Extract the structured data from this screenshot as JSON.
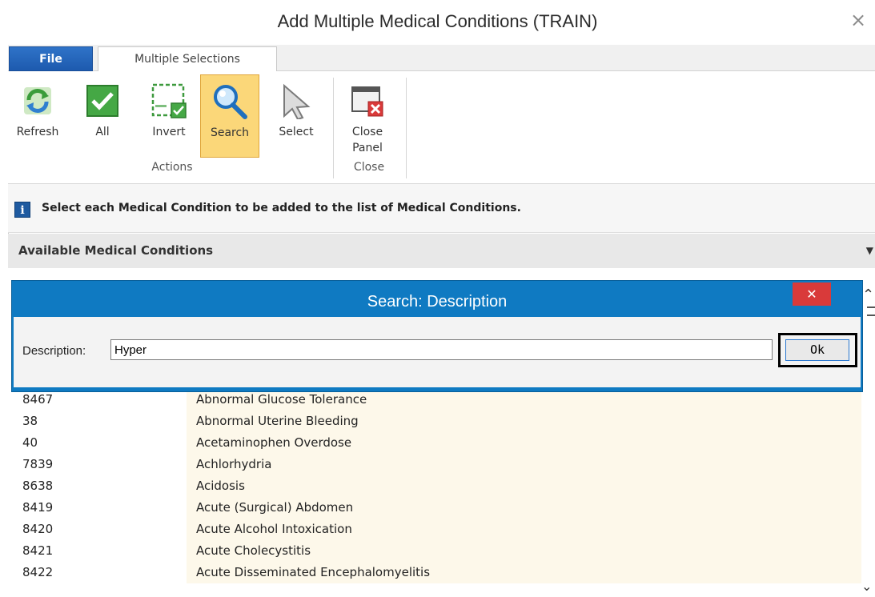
{
  "window": {
    "title": "Add Multiple Medical Conditions (TRAIN)",
    "close_glyph": "×"
  },
  "ribbon": {
    "tabs": [
      {
        "label": "File"
      },
      {
        "label": "Multiple Selections"
      }
    ],
    "buttons": [
      {
        "label": "Refresh",
        "icon": "refresh-icon"
      },
      {
        "label": "All",
        "icon": "check-all-icon"
      },
      {
        "label": "Invert",
        "icon": "invert-selection-icon"
      },
      {
        "label": "Search",
        "icon": "magnifier-icon",
        "active": true
      },
      {
        "label": "Select",
        "icon": "cursor-arrow-icon"
      },
      {
        "label": "Close Panel",
        "icon": "close-panel-icon"
      }
    ],
    "groups": [
      {
        "label": "Actions"
      },
      {
        "label": "Close"
      }
    ]
  },
  "info": {
    "message": "Select each Medical Condition to be added to the list of Medical Conditions."
  },
  "section": {
    "title": "Available Medical Conditions"
  },
  "conditions": [
    {
      "code": "8467",
      "description": "Abnormal Glucose Tolerance"
    },
    {
      "code": "38",
      "description": "Abnormal Uterine Bleeding"
    },
    {
      "code": "40",
      "description": "Acetaminophen Overdose"
    },
    {
      "code": "7839",
      "description": "Achlorhydria"
    },
    {
      "code": "8638",
      "description": "Acidosis"
    },
    {
      "code": "8419",
      "description": "Acute (Surgical) Abdomen"
    },
    {
      "code": "8420",
      "description": "Acute Alcohol Intoxication"
    },
    {
      "code": "8421",
      "description": "Acute Cholecystitis"
    },
    {
      "code": "8422",
      "description": "Acute Disseminated Encephalomyelitis"
    }
  ],
  "search_dialog": {
    "title": "Search: Description",
    "label": "Description:",
    "value": "Hyper",
    "ok_label": "Ok",
    "close_glyph": "✕"
  },
  "colors": {
    "accent": "#0f7ac2",
    "file_tab": "#2f73c8",
    "active_button": "#fbd779",
    "row_highlight": "#fdf8ea",
    "dialog_close": "#d93a3a"
  }
}
